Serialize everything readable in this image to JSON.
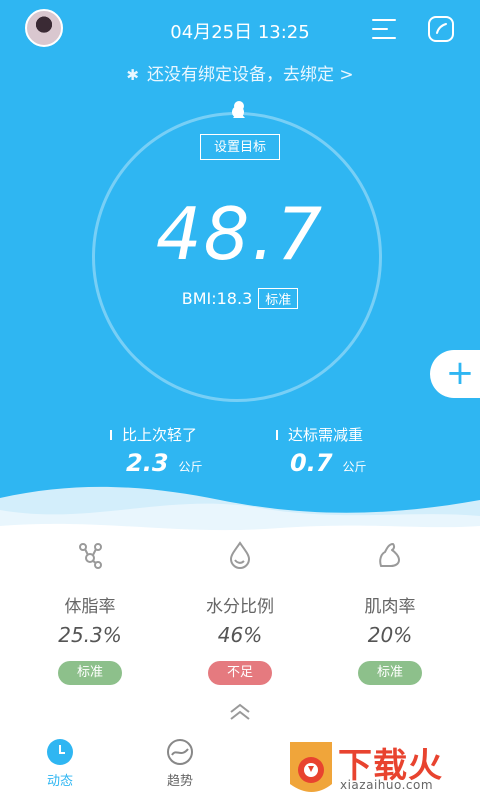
{
  "header": {
    "datetime": "04月25日 13:25",
    "bind_text": "还没有绑定设备，去绑定 >"
  },
  "main": {
    "target_label": "设置目标",
    "weight": "48.7",
    "bmi_text": "BMI:18.3",
    "bmi_status": "标准",
    "stats": [
      {
        "label": "比上次轻了",
        "value": "2.3",
        "unit": "公斤"
      },
      {
        "label": "达标需减重",
        "value": "0.7",
        "unit": "公斤"
      }
    ],
    "add_symbol": "+"
  },
  "metrics": [
    {
      "name": "体脂率",
      "value": "25.3%",
      "status": "标准",
      "icon": "molecule-icon",
      "color": "#8dc08b"
    },
    {
      "name": "水分比例",
      "value": "46%",
      "status": "不足",
      "icon": "water-drop-icon",
      "color": "#e57a7f"
    },
    {
      "name": "肌肉率",
      "value": "20%",
      "status": "标准",
      "icon": "muscle-arm-icon",
      "color": "#8dc08b"
    }
  ],
  "tabs": [
    {
      "label": "动态",
      "icon": "clock-icon",
      "active": true
    },
    {
      "label": "趋势",
      "icon": "trend-icon",
      "active": false
    }
  ],
  "watermark": {
    "text": "下载火",
    "sub": "xiazaihuo.com"
  },
  "colors": {
    "primary": "#2fb6f2",
    "green": "#8dc08b",
    "red": "#e57a7f",
    "tab_active": "#2fb6f2",
    "tab_inactive": "#666666"
  }
}
